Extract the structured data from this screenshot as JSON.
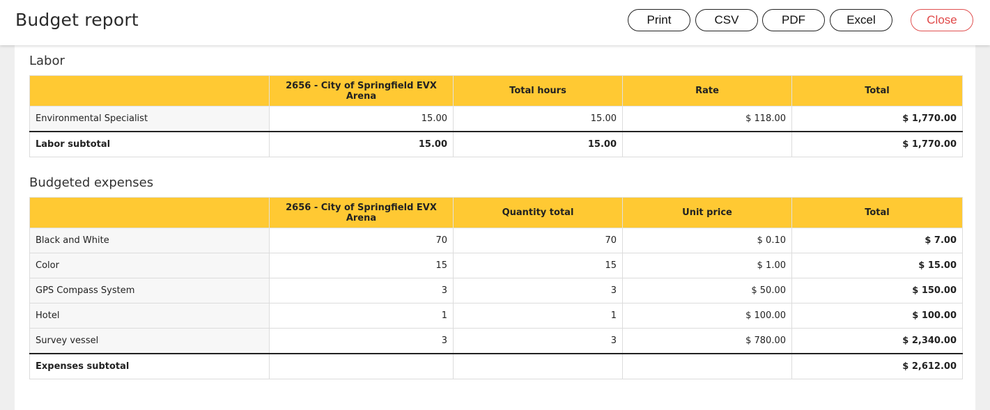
{
  "header": {
    "title": "Budget report",
    "buttons": {
      "print": "Print",
      "csv": "CSV",
      "pdf": "PDF",
      "excel": "Excel",
      "close": "Close"
    }
  },
  "colors": {
    "table_header": "#ffc933",
    "close_button": "#e04848"
  },
  "labor": {
    "title": "Labor",
    "columns": [
      "",
      "2656 - City of Springfield EVX Arena",
      "Total hours",
      "Rate",
      "Total"
    ],
    "rows": [
      {
        "label": "Environmental Specialist",
        "site": "15.00",
        "qty": "15.00",
        "rate": "$ 118.00",
        "total": "$ 1,770.00"
      }
    ],
    "subtotal": {
      "label": "Labor subtotal",
      "site": "15.00",
      "qty": "15.00",
      "rate": "",
      "total": "$ 1,770.00"
    }
  },
  "expenses": {
    "title": "Budgeted expenses",
    "columns": [
      "",
      "2656 - City of Springfield EVX Arena",
      "Quantity total",
      "Unit price",
      "Total"
    ],
    "rows": [
      {
        "label": "Black and White",
        "site": "70",
        "qty": "70",
        "rate": "$ 0.10",
        "total": "$ 7.00"
      },
      {
        "label": "Color",
        "site": "15",
        "qty": "15",
        "rate": "$ 1.00",
        "total": "$ 15.00"
      },
      {
        "label": "GPS Compass System",
        "site": "3",
        "qty": "3",
        "rate": "$ 50.00",
        "total": "$ 150.00"
      },
      {
        "label": "Hotel",
        "site": "1",
        "qty": "1",
        "rate": "$ 100.00",
        "total": "$ 100.00"
      },
      {
        "label": "Survey vessel",
        "site": "3",
        "qty": "3",
        "rate": "$ 780.00",
        "total": "$ 2,340.00"
      }
    ],
    "subtotal": {
      "label": "Expenses subtotal",
      "site": "",
      "qty": "",
      "rate": "",
      "total": "$ 2,612.00"
    }
  }
}
